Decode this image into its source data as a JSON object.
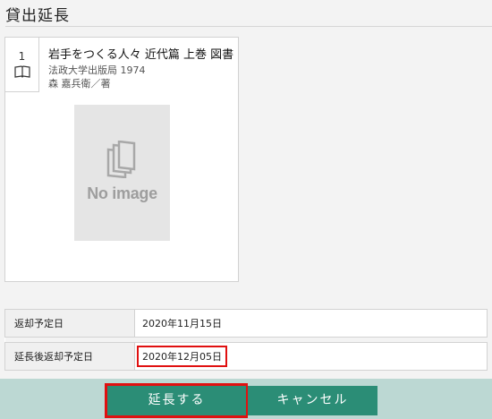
{
  "page": {
    "title": "貸出延長"
  },
  "item": {
    "index": "1",
    "title": "岩手をつくる人々 近代篇 上巻 図書",
    "publisher": "法政大学出版局 1974",
    "author": "森 嘉兵衛／著",
    "image_placeholder": "No image",
    "icons": {
      "type": "book-icon",
      "placeholder": "document-icon"
    }
  },
  "details": {
    "due_label": "返却予定日",
    "due_value": "2020年11月15日",
    "new_due_label": "延長後返却予定日",
    "new_due_value": "2020年12月05日"
  },
  "actions": {
    "extend_label": "延長する",
    "cancel_label": "キャンセル"
  },
  "colors": {
    "button": "#2b8d76",
    "footer": "#bcd8d3",
    "highlight": "#e01010",
    "background": "#f3f3f3"
  }
}
